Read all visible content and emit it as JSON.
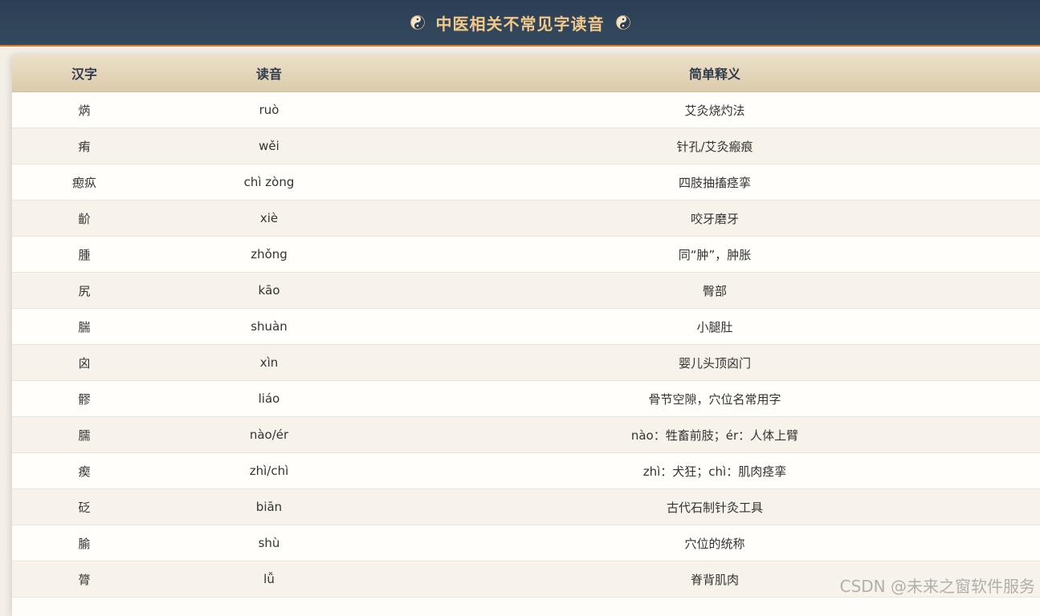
{
  "header": {
    "title": "中医相关不常见字读音"
  },
  "table": {
    "columns": [
      "汉字",
      "读音",
      "简单释义"
    ],
    "rows": [
      [
        "焫",
        "ruò",
        "艾灸烧灼法"
      ],
      [
        "痏",
        "wěi",
        "针孔/艾灸瘢痕"
      ],
      [
        "瘛疭",
        "chì zòng",
        "四肢抽搐痉挛"
      ],
      [
        "齘",
        "xiè",
        "咬牙磨牙"
      ],
      [
        "腫",
        "zhǒng",
        "同“肿”，肿胀"
      ],
      [
        "尻",
        "kāo",
        "臀部"
      ],
      [
        "腨",
        "shuàn",
        "小腿肚"
      ],
      [
        "囟",
        "xìn",
        "婴儿头顶囟门"
      ],
      [
        "髎",
        "liáo",
        "骨节空隙，穴位名常用字"
      ],
      [
        "臑",
        "nào/ér",
        "nào：牲畜前肢；ér：人体上臂"
      ],
      [
        "瘈",
        "zhì/chì",
        "zhì：犬狂；chì：肌肉痉挛"
      ],
      [
        "砭",
        "biān",
        "古代石制针灸工具"
      ],
      [
        "腧",
        "shù",
        "穴位的统称"
      ],
      [
        "膂",
        "lǚ",
        "脊背肌肉"
      ]
    ]
  },
  "watermark": "CSDN @未来之窗软件服务",
  "colors": {
    "header_bg": "#2c3e55",
    "header_text": "#f3c98a",
    "accent_line": "#d9781e"
  }
}
